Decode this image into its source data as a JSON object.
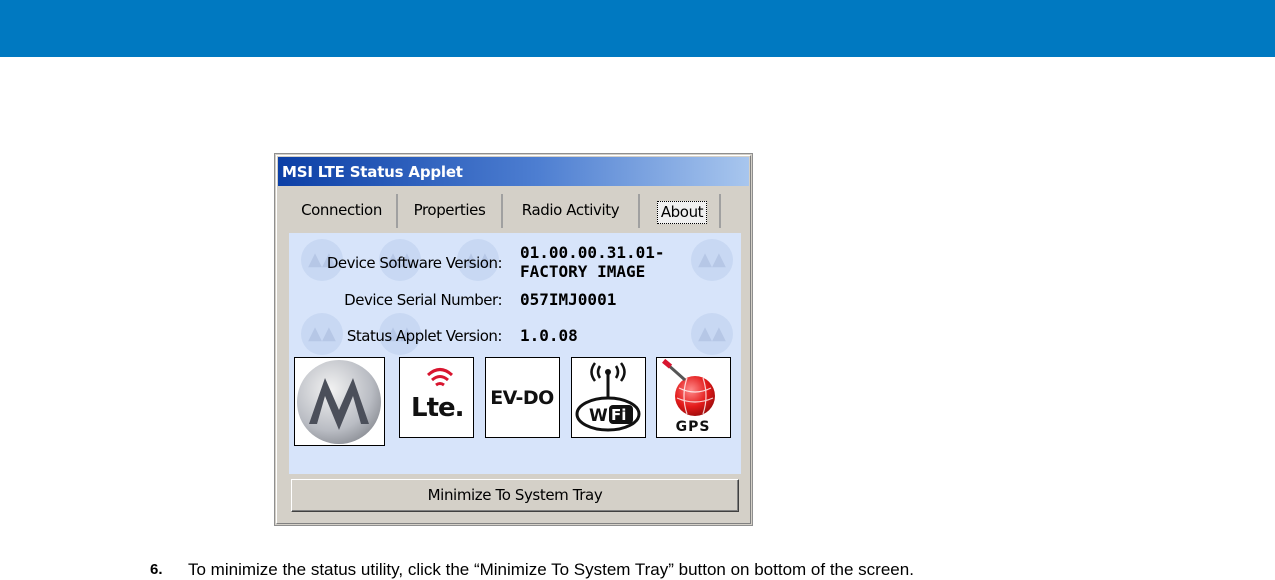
{
  "window": {
    "title": "MSI LTE Status Applet"
  },
  "tabs": [
    {
      "label": "Connection"
    },
    {
      "label": "Properties"
    },
    {
      "label": "Radio Activity"
    },
    {
      "label": "About",
      "selected": true
    }
  ],
  "about": {
    "rows": [
      {
        "label": "Device Software Version:",
        "value_line1": "01.00.00.31.01-",
        "value_line2": "FACTORY IMAGE"
      },
      {
        "label": "Device Serial Number:",
        "value": "057IMJ0001"
      },
      {
        "label": "Status Applet Version:",
        "value": "1.0.08"
      }
    ],
    "logos": [
      {
        "icon": "motorola-logo-icon"
      },
      {
        "icon": "lte-logo-icon",
        "text": "Lte."
      },
      {
        "icon": "ev-do-logo-icon",
        "text": "EV-DO"
      },
      {
        "icon": "wifi-logo-icon",
        "text_a": "Wi",
        "text_b": "Fi"
      },
      {
        "icon": "gps-logo-icon",
        "text": "GPS"
      }
    ]
  },
  "minimize_button": {
    "label": "Minimize To System Tray"
  },
  "instruction": {
    "number": "6.",
    "text": "To minimize the status utility, click the “Minimize To System Tray” button on bottom of the screen."
  },
  "colors": {
    "header_band": "#0079c1",
    "content_bg": "#d7e4fa",
    "window_bg": "#d4d0c8"
  }
}
